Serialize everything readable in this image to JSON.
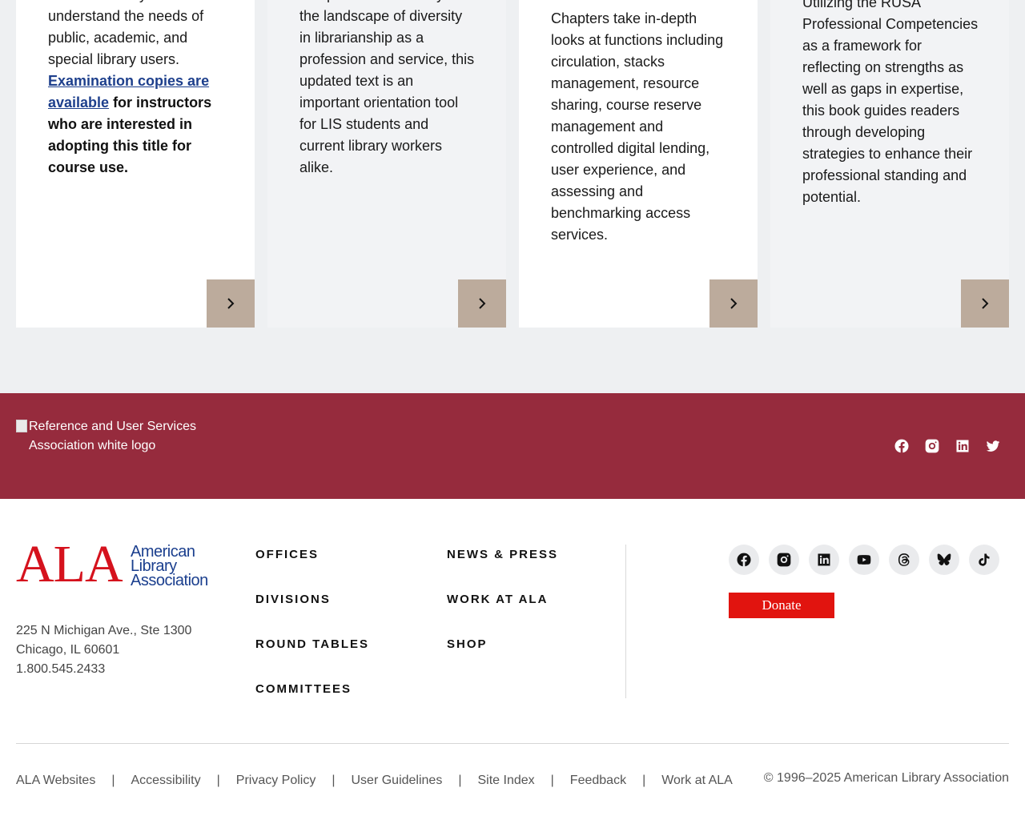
{
  "cards": [
    {
      "lines_before_link": "that will teach you how to understand the needs of public, academic, and special library users.",
      "link_text": "Examination copies are available",
      "bold_after_link": " for instructors who are interested in adopting this title for course use."
    },
    {
      "text": "comprehensive survey of the landscape of diversity in librarianship as a profession and service, this updated text is an important orientation tool for LIS students and current library workers alike."
    },
    {
      "text": "Chapters take in-depth looks at functions including circulation, stacks management, resource sharing, course reserve management and controlled digital lending, user experience, and assessing and benchmarking access services."
    },
    {
      "text": "Utilizing the RUSA Professional Competencies as a framework for reflecting on strengths as well as gaps in expertise, this book guides readers through developing strategies to enhance their professional standing and potential."
    }
  ],
  "rusa": {
    "logo_alt": "Reference and User Services Association white logo",
    "social_icons": [
      "facebook-icon",
      "instagram-icon",
      "linkedin-icon",
      "twitter-icon"
    ]
  },
  "ala": {
    "logo_letters": "ALA",
    "logo_words": [
      "American",
      "Library",
      "Association"
    ],
    "address_line1": "225 N Michigan Ave., Ste 1300",
    "address_line2": "Chicago, IL 60601",
    "phone": "1.800.545.2433",
    "nav_col1": [
      "OFFICES",
      "DIVISIONS",
      "ROUND TABLES",
      "COMMITTEES"
    ],
    "nav_col2": [
      "NEWS & PRESS",
      "WORK AT ALA",
      "SHOP"
    ],
    "social_icons": [
      "facebook-icon",
      "instagram-icon",
      "linkedin-icon",
      "youtube-icon",
      "threads-icon",
      "bluesky-icon",
      "tiktok-icon"
    ],
    "donate_label": "Donate"
  },
  "footer": {
    "links": [
      "ALA Websites",
      "Accessibility",
      "Privacy Policy",
      "User Guidelines",
      "Site Index",
      "Feedback",
      "Work at ALA"
    ],
    "separator": "|",
    "copyright": "© 1996–2025 American Library Association"
  },
  "colors": {
    "rusa_band": "#962b3d",
    "card_arrow": "#bcab9c",
    "ala_red": "#d5121d",
    "ala_blue": "#1b3f8e",
    "donate": "#e1140f"
  }
}
